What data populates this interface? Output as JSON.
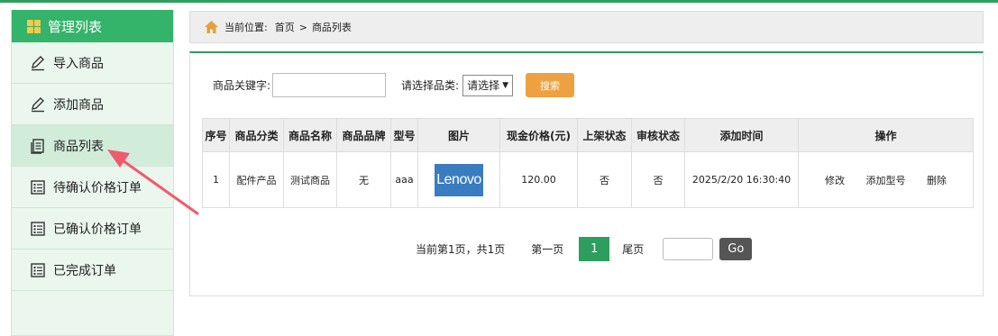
{
  "sidebar": {
    "title": "管理列表",
    "items": [
      {
        "label": "导入商品",
        "icon": "pen-icon"
      },
      {
        "label": "添加商品",
        "icon": "pen-icon"
      },
      {
        "label": "商品列表",
        "icon": "document-icon",
        "active": true
      },
      {
        "label": "待确认价格订单",
        "icon": "list-icon"
      },
      {
        "label": "已确认价格订单",
        "icon": "list-icon"
      },
      {
        "label": "已完成订单",
        "icon": "list-icon"
      }
    ]
  },
  "breadcrumb": {
    "prefix": "当前位置:",
    "home": "首页",
    "separator": ">",
    "current": "商品列表"
  },
  "search": {
    "keyword_label": "商品关键字:",
    "keyword_value": "",
    "category_label": "请选择品类:",
    "category_selected": "请选择",
    "button_label": "搜索"
  },
  "table": {
    "headers": [
      "序号",
      "商品分类",
      "商品名称",
      "商品品牌",
      "型号",
      "图片",
      "现金价格(元)",
      "上架状态",
      "审核状态",
      "添加时间",
      "操作"
    ],
    "rows": [
      {
        "index": "1",
        "category": "配件产品",
        "name": "测试商品",
        "brand": "无",
        "model": "aaa",
        "image_text": "Lenovo",
        "price": "120.00",
        "listed": "否",
        "reviewed": "否",
        "added_time": "2025/2/20 16:30:40",
        "actions": [
          "修改",
          "添加型号",
          "删除"
        ]
      }
    ]
  },
  "pagination": {
    "info": "当前第1页，共1页",
    "first": "第一页",
    "current_page": "1",
    "last": "尾页",
    "page_input_value": "",
    "go_label": "Go"
  },
  "colors": {
    "accent_green": "#2e9e5e",
    "sidebar_header": "#34b36a",
    "search_button": "#eea140",
    "annotation_arrow": "#f05a6e"
  }
}
